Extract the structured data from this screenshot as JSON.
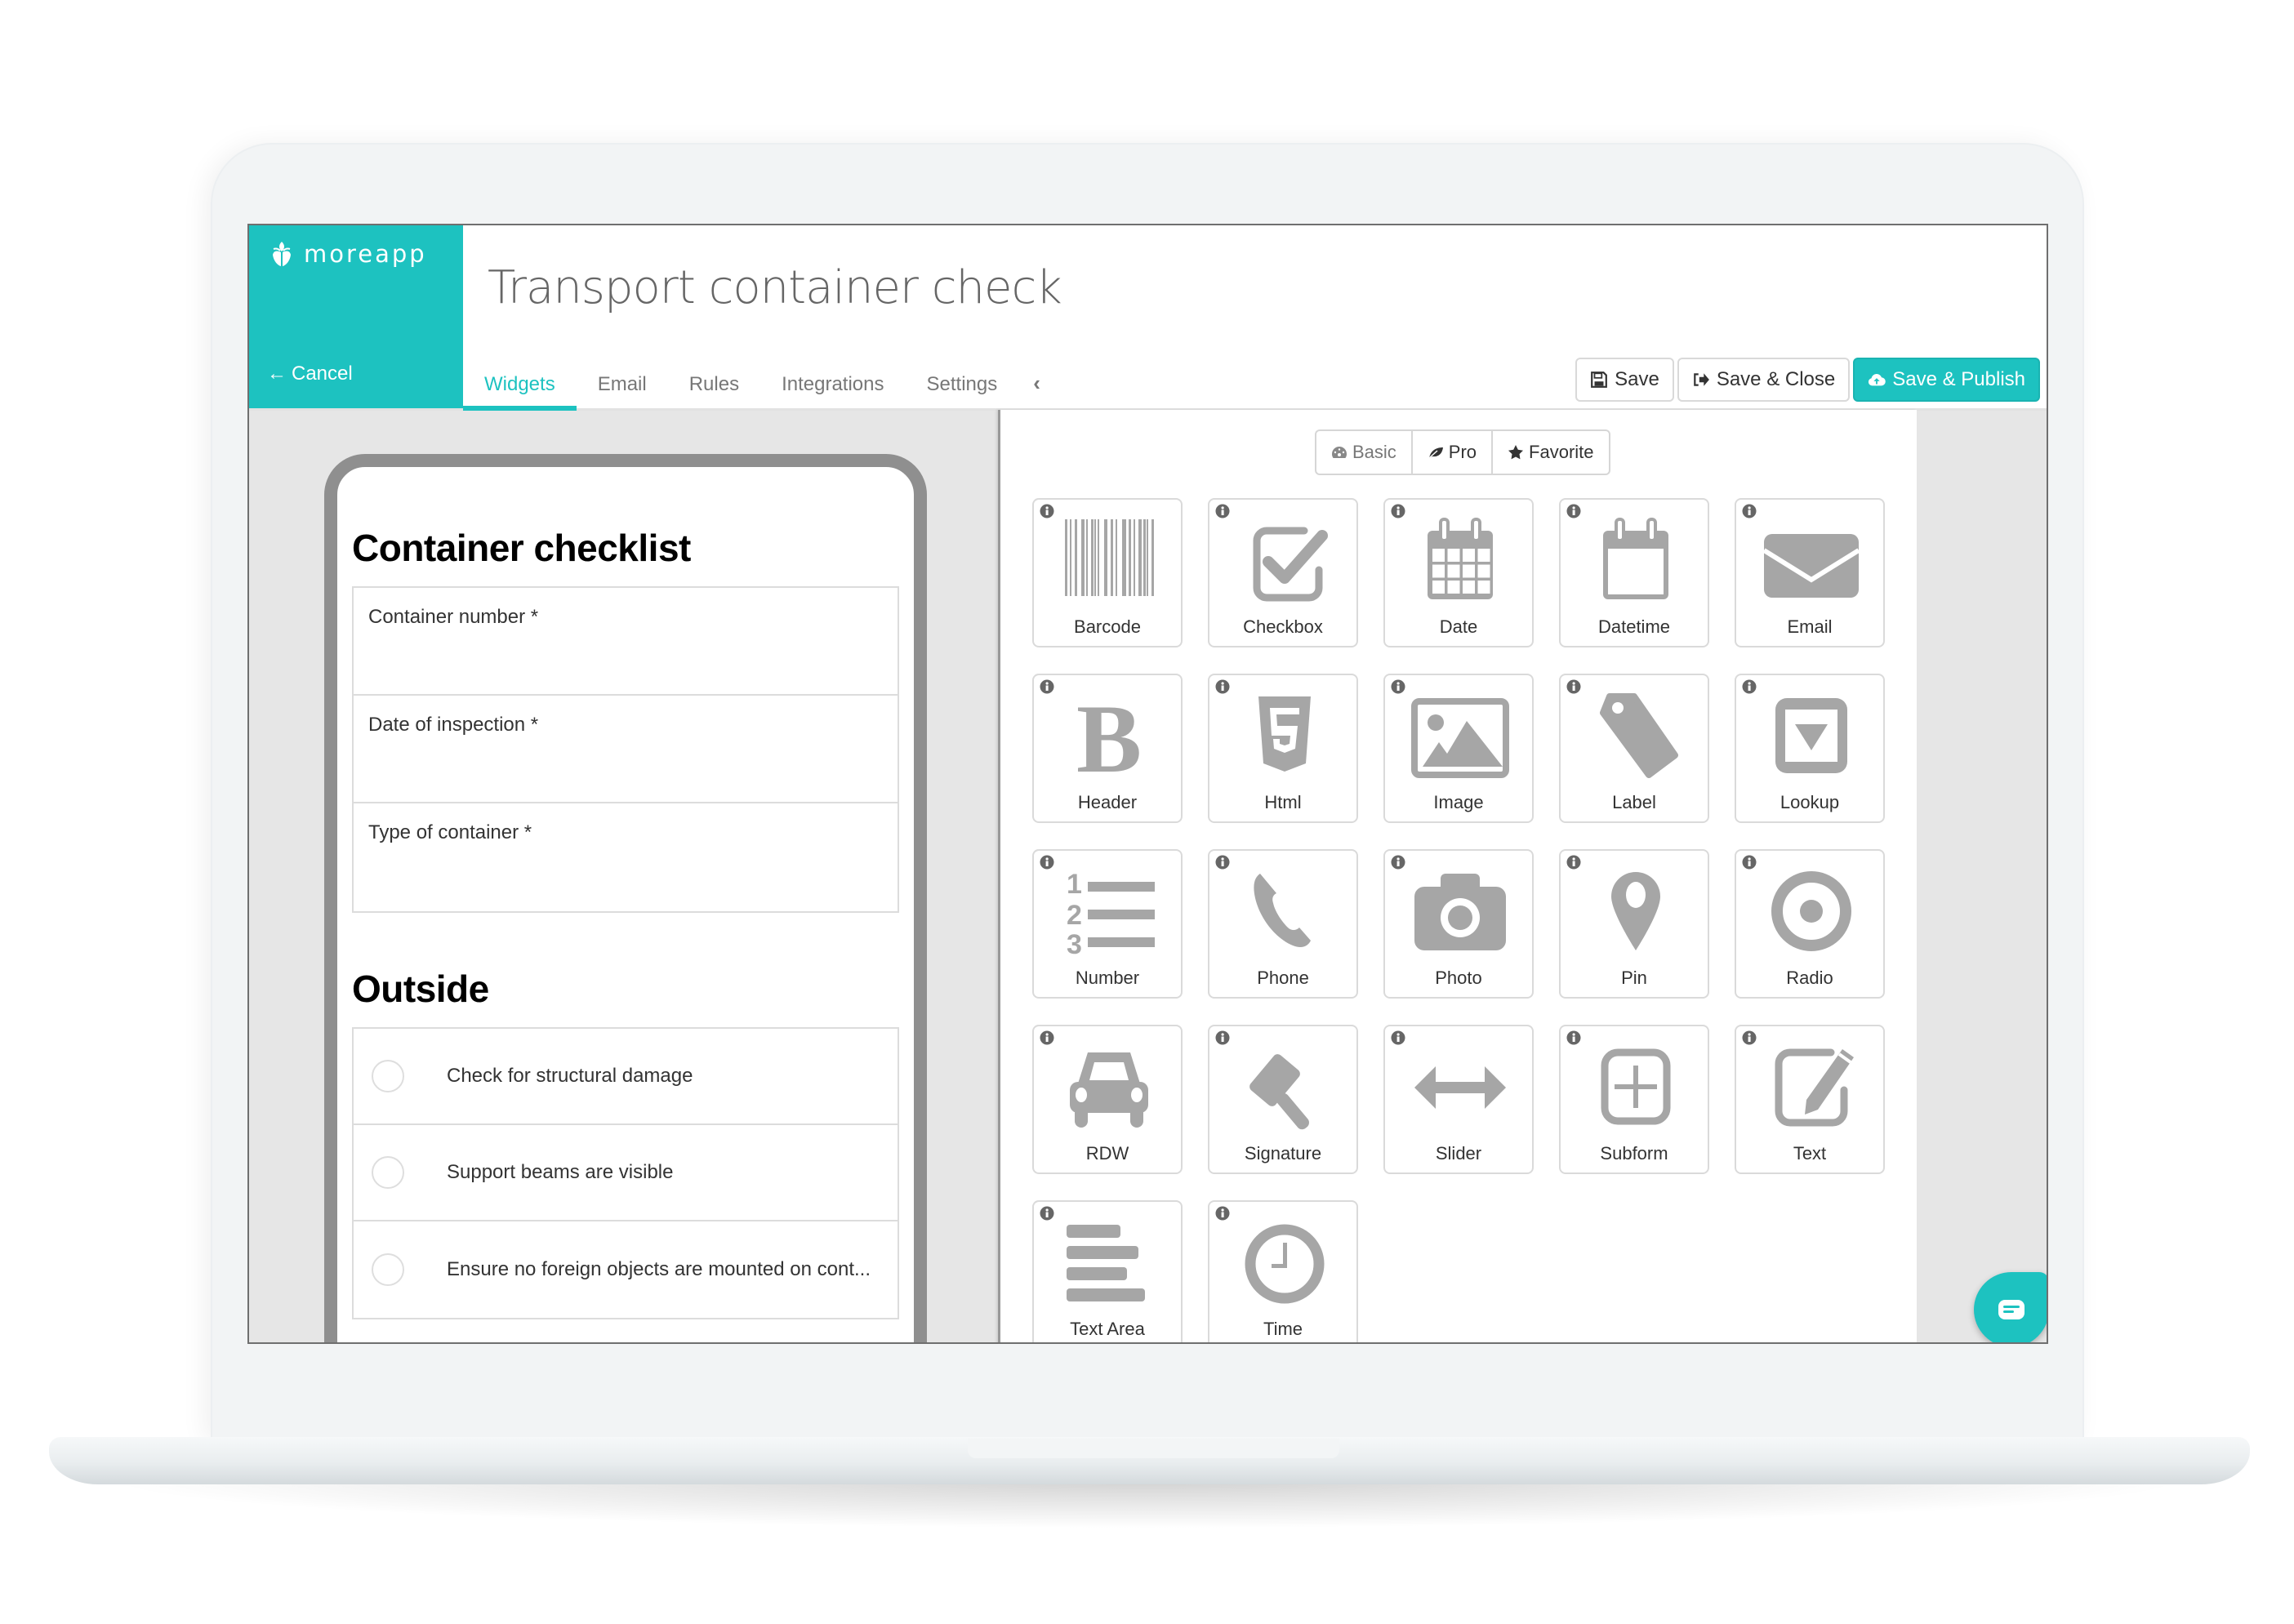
{
  "app": {
    "brand_name": "moreapp",
    "cancel_label": "Cancel",
    "title": "Transport container check",
    "accent_color": "#1dc2c0"
  },
  "tabs": [
    {
      "label": "Widgets",
      "active": true
    },
    {
      "label": "Email",
      "active": false
    },
    {
      "label": "Rules",
      "active": false
    },
    {
      "label": "Integrations",
      "active": false
    },
    {
      "label": "Settings",
      "active": false
    }
  ],
  "actions": {
    "save": "Save",
    "save_close": "Save & Close",
    "save_publish": "Save & Publish"
  },
  "preview": {
    "sections": [
      {
        "heading": "Container checklist",
        "fields": [
          "Container number *",
          "Date of inspection *",
          "Type of container *"
        ]
      },
      {
        "heading": "Outside",
        "checks": [
          "Check for structural damage",
          "Support beams are visible",
          "Ensure no foreign objects are mounted on cont..."
        ]
      }
    ]
  },
  "widget_filter": {
    "options": [
      "Basic",
      "Pro",
      "Favorite"
    ]
  },
  "widgets": [
    {
      "label": "Barcode",
      "icon": "barcode-icon"
    },
    {
      "label": "Checkbox",
      "icon": "checkbox-icon"
    },
    {
      "label": "Date",
      "icon": "calendar-icon"
    },
    {
      "label": "Datetime",
      "icon": "calendar-blank-icon"
    },
    {
      "label": "Email",
      "icon": "envelope-icon"
    },
    {
      "label": "Header",
      "icon": "bold-icon"
    },
    {
      "label": "Html",
      "icon": "html5-icon"
    },
    {
      "label": "Image",
      "icon": "image-icon"
    },
    {
      "label": "Label",
      "icon": "tag-icon"
    },
    {
      "label": "Lookup",
      "icon": "dropdown-icon"
    },
    {
      "label": "Number",
      "icon": "ordered-list-icon"
    },
    {
      "label": "Phone",
      "icon": "phone-icon"
    },
    {
      "label": "Photo",
      "icon": "camera-icon"
    },
    {
      "label": "Pin",
      "icon": "map-pin-icon"
    },
    {
      "label": "Radio",
      "icon": "radio-icon"
    },
    {
      "label": "RDW",
      "icon": "car-icon"
    },
    {
      "label": "Signature",
      "icon": "gavel-icon"
    },
    {
      "label": "Slider",
      "icon": "arrows-horizontal-icon"
    },
    {
      "label": "Subform",
      "icon": "plus-square-icon"
    },
    {
      "label": "Text",
      "icon": "edit-icon"
    },
    {
      "label": "Text Area",
      "icon": "align-left-icon"
    },
    {
      "label": "Time",
      "icon": "clock-icon"
    }
  ]
}
